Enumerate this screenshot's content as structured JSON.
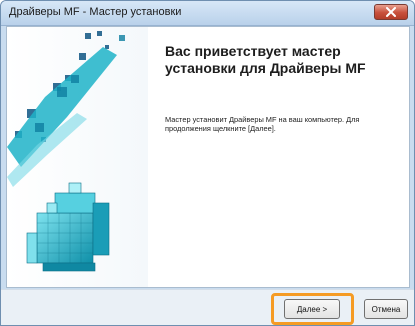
{
  "window": {
    "title": "Драйверы MF - Мастер установки"
  },
  "content": {
    "heading": "Вас приветствует мастер установки для Драйверы MF",
    "description": "Мастер установит Драйверы MF на ваш компьютер. Для продолжения щелкните [Далее]."
  },
  "buttons": {
    "next_label": "Далее >",
    "cancel_label": "Отмена"
  },
  "colors": {
    "highlight": "#f59b24",
    "art_accent": "#1fb3c8"
  },
  "icons": {
    "close": "close-icon",
    "art": "installer-cubes-artwork"
  }
}
